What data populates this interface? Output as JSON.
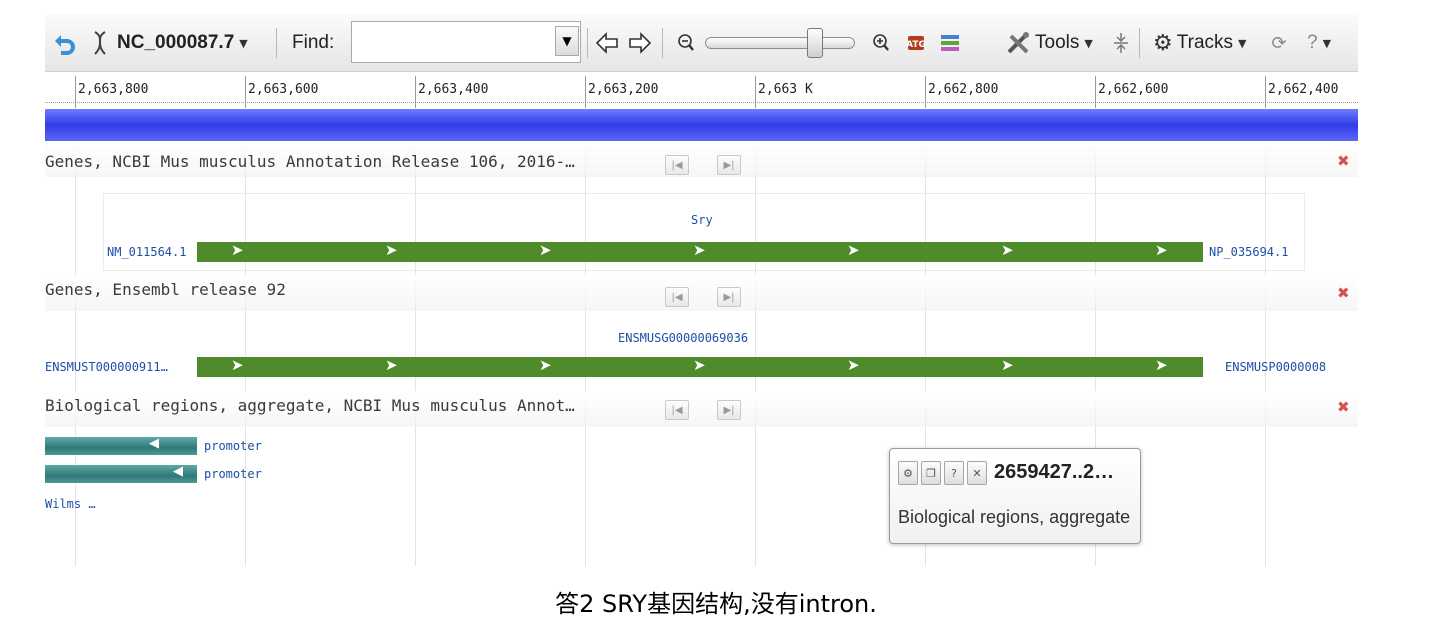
{
  "toolbar": {
    "refseq": "NC_000087.7",
    "find_label": "Find:",
    "find_value": "",
    "tools_label": "Tools",
    "tracks_label": "Tracks",
    "help_label": "?"
  },
  "ruler": {
    "ticks": [
      "2,663,800",
      "2,663,600",
      "2,663,400",
      "2,663,200",
      "2,663 K",
      "2,662,800",
      "2,662,600",
      "2,662,400"
    ]
  },
  "tracks": {
    "ncbi_genes": {
      "title": "Genes, NCBI Mus musculus Annotation Release 106, 2016-…",
      "gene_name": "Sry",
      "transcript": "NM_011564.1",
      "protein": "NP_035694.1"
    },
    "ensembl_genes": {
      "title": "Genes, Ensembl release 92",
      "gene_id": "ENSMUSG00000069036",
      "transcript": "ENSMUST000000911…",
      "protein": "ENSMUSP0000008"
    },
    "bio_regions": {
      "title": "Biological regions, aggregate, NCBI Mus musculus Annot…",
      "features": [
        "promoter",
        "promoter"
      ],
      "wilms": "Wilms …"
    }
  },
  "popup": {
    "range": "2659427..2…",
    "desc": "Biological regions, aggregate"
  },
  "caption": "答2 SRY基因结构,没有intron.",
  "colors": {
    "gene_bar": "#4f8a2b",
    "overview": "#2f3de8",
    "promoter": "#2f7a78",
    "link": "#1d4fa8",
    "close": "#d95050"
  },
  "icons": [
    "back-icon",
    "dna-icon",
    "pan-left-icon",
    "pan-right-icon",
    "zoom-out-icon",
    "zoom-in-icon",
    "gc-content-icon",
    "track-config-icon",
    "tools-icon",
    "collapse-icon",
    "gear-icon",
    "sync-icon",
    "help-icon"
  ]
}
